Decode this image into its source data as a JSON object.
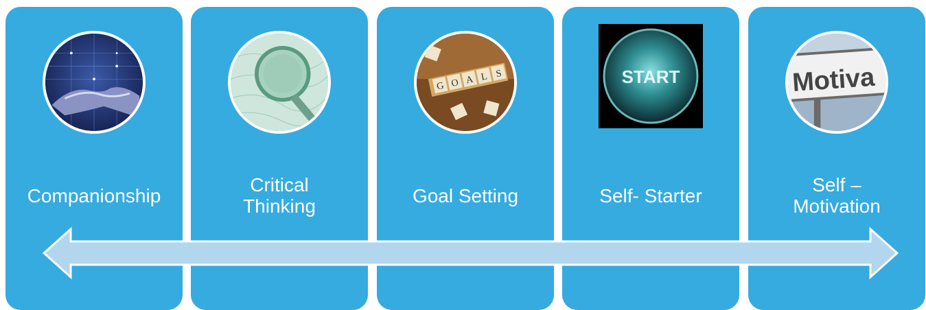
{
  "diagram": {
    "colors": {
      "card": "#35abe0",
      "label_text": "#ffffff",
      "arrow_fill": "#b2d6ee",
      "arrow_stroke": "#ffffff"
    },
    "arrow": {
      "direction": "bidirectional"
    },
    "cards": [
      {
        "label": "Companionship",
        "image": "handshake-image"
      },
      {
        "label": "Critical\nThinking",
        "image": "magnifying-glass-image"
      },
      {
        "label": "Goal Setting",
        "image": "goals-tiles-image"
      },
      {
        "label": "Self- Starter",
        "image": "start-button-image",
        "image_text": "START"
      },
      {
        "label": "Self –\nMotivation",
        "image": "motivation-sign-image",
        "image_text": "Motiva"
      }
    ]
  }
}
